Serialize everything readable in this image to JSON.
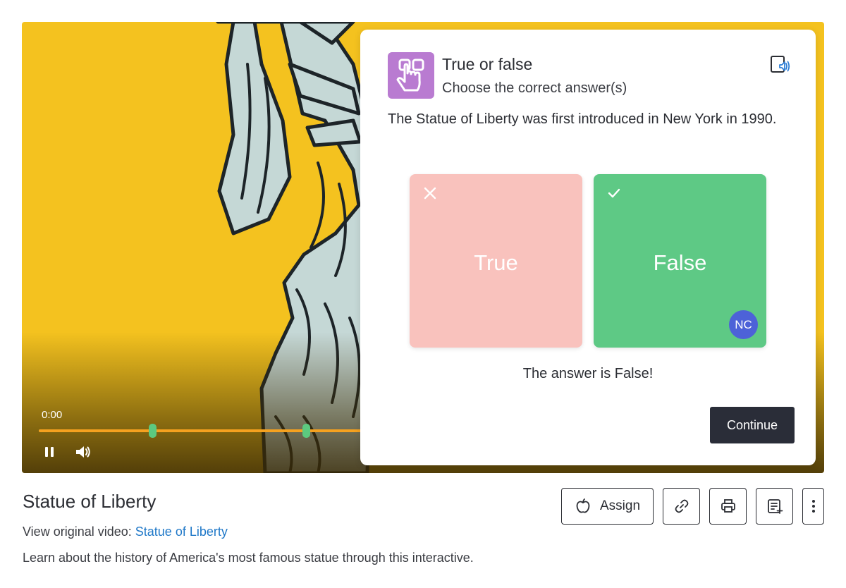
{
  "video": {
    "time": "0:00",
    "progress_fraction": 1.0,
    "marker_fractions": [
      0.148,
      0.348
    ],
    "controls": {
      "play_state": "pause-icon",
      "volume": "volume-icon"
    }
  },
  "quiz": {
    "type": "True or false",
    "instruction": "Choose the correct answer(s)",
    "question": "The Statue of Liberty was first introduced in New York in 1990.",
    "choices": [
      {
        "label": "True",
        "state": "incorrect",
        "mark": "x-icon"
      },
      {
        "label": "False",
        "state": "correct",
        "mark": "check-icon"
      }
    ],
    "avatar_initials": "NC",
    "result_prefix": "The answer is ",
    "result_answer": "False!",
    "continue_label": "Continue",
    "colors": {
      "icon_bg": "#b97bd1",
      "wrong": "#f9c2bd",
      "right": "#5ec985",
      "avatar": "#4d62d8",
      "continue_bg": "#2a2d38"
    }
  },
  "page": {
    "title": "Statue of Liberty",
    "original_prefix": "View original video:",
    "original_link": "Statue of Liberty",
    "description": "Learn about the history of America's most famous statue through this interactive.",
    "actions": {
      "assign_label": "Assign"
    }
  },
  "colors": {
    "video_bg": "#f4c21f",
    "progress": "#f5a11f",
    "marker": "#5cc97f",
    "link": "#1f78c8"
  }
}
